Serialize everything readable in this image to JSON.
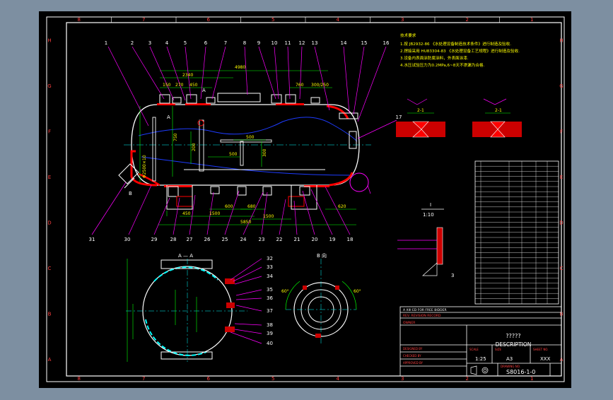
{
  "colors": {
    "background": "#7d8fa1",
    "sheet": "#000000",
    "frame": "#ffffff",
    "part": "#ffffff",
    "leader": "#ff00ff",
    "dimension": "#00ff00",
    "accent": "#ff0000",
    "fill": "#cc0000",
    "center": "#00ffff",
    "hidden": "#1e3cff",
    "text": "#ffff00"
  },
  "border": {
    "columns": [
      "8",
      "7",
      "6",
      "5",
      "4",
      "3",
      "2",
      "1"
    ],
    "rows": [
      "H",
      "G",
      "F",
      "E",
      "D",
      "C",
      "B",
      "A"
    ]
  },
  "balloons": {
    "top": [
      "1",
      "2",
      "3",
      "4",
      "5",
      "6",
      "7",
      "8",
      "9",
      "10",
      "11",
      "12",
      "13",
      "14",
      "15",
      "16",
      "17"
    ],
    "bottom": [
      "31",
      "30",
      "29",
      "28",
      "27",
      "26",
      "25",
      "24",
      "23",
      "22",
      "21",
      "20",
      "19",
      "18"
    ],
    "section": [
      "32",
      "33",
      "34",
      "35",
      "36",
      "37",
      "38",
      "39",
      "40"
    ]
  },
  "dimensions": {
    "overall_length": "4980",
    "span_top": "2340",
    "seg_150": "150",
    "seg_270": "270",
    "seg_450": "450",
    "seg_760": "760",
    "seg_300_250": "300/250",
    "diameter": "Φ2500×10",
    "d_750": "750",
    "d_200": "200",
    "d_500a": "500",
    "d_500b": "500",
    "d_300": "300",
    "d_1500": "1500",
    "d_600": "600",
    "d_680": "680",
    "d_620": "620",
    "d_450": "450",
    "support": "5850",
    "d_1500b": "1500",
    "angle_60a": "60°",
    "angle_60b": "60°",
    "weld_len_a": "2-1",
    "weld_len_b": "2-1"
  },
  "view_labels": {
    "section_a": "A — A",
    "section_b": "B 向",
    "detail_i": "I",
    "detail_scale": "1:10",
    "detail_num": "3",
    "mark_a_left": "A",
    "mark_a_right": "A",
    "mark_b": "B"
  },
  "notes": {
    "title": "技术要求",
    "lines": [
      "1.按 JB2932-86 《水处理设备制造技术条件》进行制造及验收.",
      "2.焊接采用 HU83304-83 《水处理设备工艺规程》进行制造及验收.",
      "3.设备内表面涂防腐涂料，外表面涂漆.",
      "4.水压试验压力为0.2MPa,6~8天不渗漏为合格."
    ]
  },
  "title_block": {
    "revision_header": "A    XIII    ED FOR FREE BIDDER",
    "revision_sub": "REV.  REVISION RECORD",
    "owner": "OWNER",
    "name_cn": "?????",
    "name_en": "DESCRIPTION",
    "scale_label": "SCALE",
    "scale": "1:25",
    "size_label": "SIZE",
    "size": "A3",
    "sheet_label": "SHEET NO.",
    "sheet": "XXX",
    "drawing_no_label": "DRAWING NO.",
    "drawing_no": "S8016-1-0",
    "roles": [
      "DESIGNED BY",
      "CHECKED BY",
      "APPROVED BY"
    ]
  }
}
